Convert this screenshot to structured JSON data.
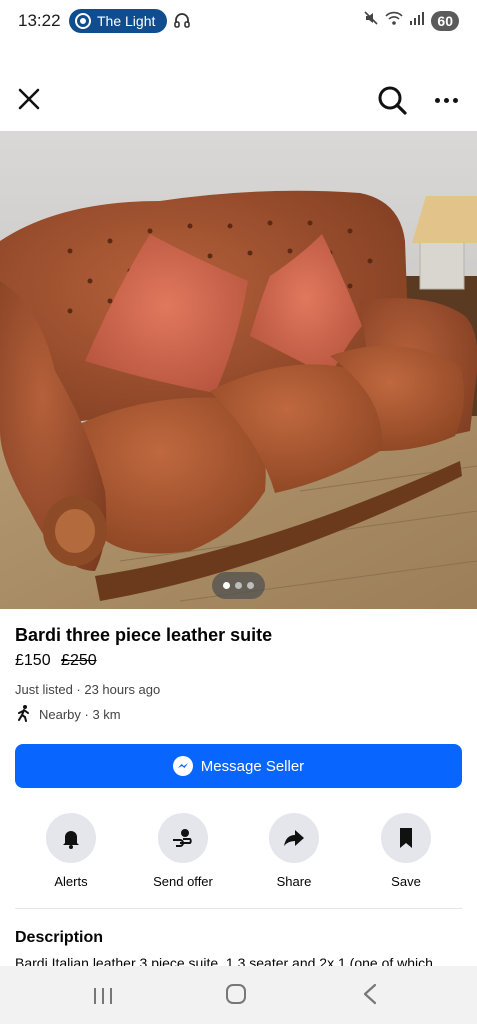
{
  "status_bar": {
    "time": "13:22",
    "media_label": "The Light",
    "battery": "60",
    "icons": [
      "headphones-icon",
      "mute-icon",
      "wifi-icon",
      "signal-icon"
    ]
  },
  "top_bar": {
    "icons": [
      "close-icon",
      "search-icon",
      "more-icon"
    ]
  },
  "photo": {
    "subject": "brown leather three-seater sofa with orange cushions",
    "page_count": 3,
    "current_page": 1
  },
  "listing": {
    "title": "Bardi three piece leather suite",
    "price": "£150",
    "original_price": "£250",
    "listed": "Just listed · 23 hours ago",
    "distance": "Nearby · 3 km"
  },
  "message_button": {
    "label": "Message Seller",
    "icon": "messenger-icon"
  },
  "actions": [
    {
      "label": "Alerts",
      "icon": "bell-icon"
    },
    {
      "label": "Send offer",
      "icon": "offer-icon"
    },
    {
      "label": "Share",
      "icon": "share-icon"
    },
    {
      "label": "Save",
      "icon": "bookmark-icon"
    }
  ],
  "description": {
    "heading": "Description",
    "text": "Bardi Italian leather 3 piece suite, 1 3 seater and 2x 1 (one of which"
  },
  "colors": {
    "accent": "#0866ff",
    "action_bg": "#e4e6eb",
    "media_pill": "#0f4d8f"
  }
}
